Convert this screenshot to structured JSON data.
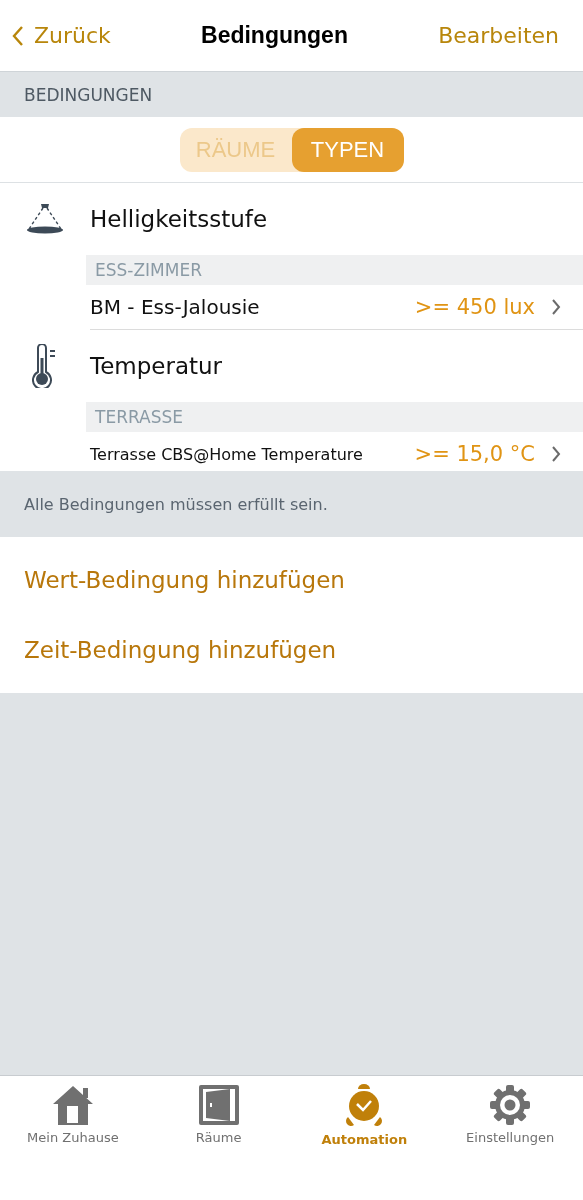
{
  "nav": {
    "back": "Zurück",
    "title": "Bedingungen",
    "action": "Bearbeiten"
  },
  "section_header": "BEDINGUNGEN",
  "segments": [
    {
      "label": "RÄUME",
      "selected": false
    },
    {
      "label": "TYPEN",
      "selected": true
    }
  ],
  "groups": [
    {
      "kind": "light",
      "title": "Helligkeitsstufe",
      "room": "ESS-ZIMMER",
      "items": [
        {
          "name": "BM - Ess-Jalousie",
          "value": ">= 450 lux",
          "kind": "regular"
        }
      ]
    },
    {
      "kind": "temperature",
      "title": "Temperatur",
      "room": "TERRASSE",
      "items": [
        {
          "name": "Terrasse CBS@Home Temperature",
          "value": ">= 15,0 °C",
          "kind": "compact"
        }
      ]
    }
  ],
  "footer_note": "Alle Bedingungen müssen erfüllt sein.",
  "actions": [
    "Wert-Bedingung hinzufügen",
    "Zeit-Bedingung hinzufügen"
  ],
  "tabs": [
    {
      "kind": "home",
      "label": "Mein Zuhause",
      "selected": false
    },
    {
      "kind": "door",
      "label": "Räume",
      "selected": false
    },
    {
      "kind": "alarm",
      "label": "Automation",
      "selected": true
    },
    {
      "kind": "gear",
      "label": "Einstellungen",
      "selected": false
    }
  ]
}
